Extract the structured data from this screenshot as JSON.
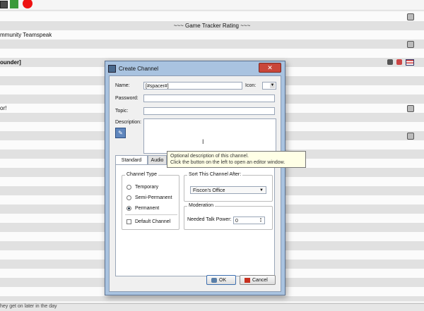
{
  "tree": {
    "rows": [
      {
        "text": "",
        "style": "",
        "icons": [
          "lock-icon"
        ]
      },
      {
        "text": "~~~ Game Tracker Rating ~~~",
        "style": "center",
        "icons": []
      },
      {
        "text": "mmunity Teamspeak",
        "style": "",
        "icons": []
      },
      {
        "text": "",
        "style": "",
        "icons": [
          "home-icon"
        ]
      },
      {
        "text": "",
        "style": "",
        "icons": []
      },
      {
        "text": "ounder]",
        "style": "bold",
        "icons": [
          "group-badge-icon",
          "shield-badge-icon",
          "flag-icon"
        ]
      },
      {
        "text": "",
        "style": "",
        "icons": []
      },
      {
        "text": "",
        "style": "",
        "icons": []
      },
      {
        "text": "",
        "style": "",
        "icons": []
      },
      {
        "text": "",
        "style": "",
        "icons": []
      },
      {
        "text": "or!",
        "style": "",
        "icons": [
          "lock-icon"
        ]
      },
      {
        "text": "",
        "style": "",
        "icons": []
      },
      {
        "text": "",
        "style": "",
        "icons": []
      },
      {
        "text": "",
        "style": "",
        "icons": [
          "lock-icon"
        ]
      }
    ]
  },
  "statusbar": {
    "text": "hey get on later in the day"
  },
  "dialog": {
    "title": "Create Channel",
    "close_glyph": "✕",
    "name_label": "Name:",
    "name_value": "[#spacer#]",
    "icon_label": "Icon:",
    "password_label": "Password:",
    "topic_label": "Topic:",
    "description_label": "Description:",
    "tabs": [
      "Standard",
      "Audio"
    ],
    "channel_type": {
      "title": "Channel Type",
      "options": [
        "Temporary",
        "Semi-Permanent",
        "Permanent"
      ],
      "selected": "Permanent",
      "default_channel_label": "Default Channel"
    },
    "sort": {
      "title": "Sort This Channel After:",
      "selected": "Fiscon's Office"
    },
    "moderation": {
      "title": "Moderation",
      "talk_power_label": "Needed Talk Power:",
      "talk_power_value": "0"
    },
    "ok_label": "OK",
    "cancel_label": "Cancel"
  },
  "tooltip": {
    "line1": "Optional description of this channel.",
    "line2": "Click the button on the left to open an editor window."
  }
}
